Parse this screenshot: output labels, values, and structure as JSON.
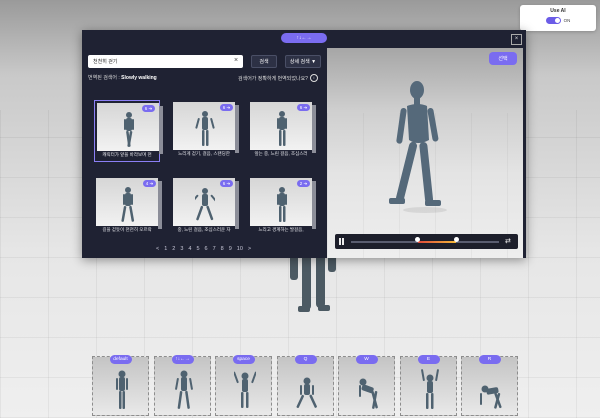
{
  "ai_toggle": {
    "title": "Use AI",
    "state": "ON"
  },
  "dialog": {
    "tab_label": "↑↓←→",
    "close_label": "×",
    "search": {
      "value": "천천히 걷기",
      "clear": "×"
    },
    "search_button": "검색",
    "detail_search_button": "상세 검색 ▼",
    "translated_prefix": "번역된 검색어 :",
    "translated_query": "Slowly walking",
    "help_text": "검색어가 정확하게 번역되었나요?",
    "help_icon": "i",
    "cards": [
      {
        "badge": "6 ➔",
        "caption": "캐릭터가 앞을 바라보며 천",
        "selected": true
      },
      {
        "badge": "6 ➔",
        "caption": "느리게 걷기, 걸음, 스탠딩한"
      },
      {
        "badge": "6 ➔",
        "caption": "앞는 중, 느린 걸음, 조심스러"
      },
      {
        "badge": "4 ➔",
        "caption": "길을 걷듯이 천천히 오르락"
      },
      {
        "badge": "6 ➔",
        "caption": "중, 느린 걸음, 조심스러운 자"
      },
      {
        "badge": "2 ➔",
        "caption": "느리고 경계하는 발걸음,"
      }
    ],
    "pagination": [
      "<",
      "1",
      "2",
      "3",
      "4",
      "5",
      "6",
      "7",
      "8",
      "9",
      "10",
      ">"
    ],
    "select_button": "선택",
    "timeline": {
      "range_start": 0.45,
      "range_end": 0.71
    }
  },
  "shortcuts": [
    {
      "key": "default"
    },
    {
      "key": "↑↓←→"
    },
    {
      "key": "space"
    },
    {
      "key": "Q"
    },
    {
      "key": "W"
    },
    {
      "key": "E"
    },
    {
      "key": "R"
    }
  ]
}
